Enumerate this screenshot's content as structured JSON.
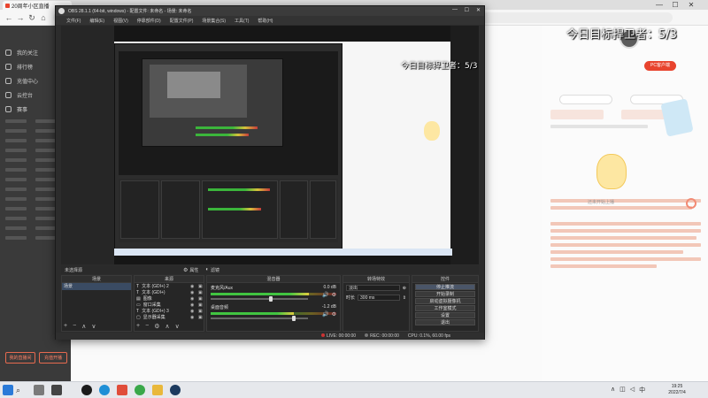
{
  "browser": {
    "tab_title": "20周年小区直播",
    "minimize": "—",
    "maximize": "☐",
    "close": "✕",
    "back": "←",
    "forward": "→",
    "refresh": "↻",
    "home": "⌂"
  },
  "site": {
    "sidebar_items": [
      "我的关注",
      "排行榜",
      "充值中心",
      "云控台",
      "赛事"
    ],
    "sidebar_buttons": [
      "我的直播间",
      "充值开播"
    ],
    "overlay_text": "今日目标捍卫者：5/3",
    "badge": "PC客户端",
    "mascot_label": "还未开始上播"
  },
  "obs": {
    "title": "OBS 28.1.1 (64-bit, windows) - 配置文件: 未命名 - 场景: 未命名",
    "menu": [
      "文件(F)",
      "编辑(E)",
      "视图(V)",
      "停靠部件(D)",
      "配置文件(P)",
      "场景集合(S)",
      "工具(T)",
      "帮助(H)"
    ],
    "preview_overlay": "今日目标捍卫者：5/3",
    "scene_bar": {
      "scene": "未选择源",
      "properties": "属性",
      "filters": "滤镜"
    },
    "docks": {
      "scenes": {
        "title": "场景",
        "items": [
          "场景"
        ]
      },
      "sources": {
        "title": "来源",
        "items": [
          "文本 (GDI+) 2",
          "文本 (GDI+)",
          "图像",
          "窗口采集",
          "文本 (GDI+) 3",
          "显示器采集"
        ]
      },
      "mixer": {
        "title": "混音器",
        "channels": [
          {
            "name": "麦克风/Aux",
            "db": "0.0 dB",
            "level": 0.78,
            "volume": 0.62
          },
          {
            "name": "桌面音频",
            "db": "-1.2 dB",
            "level": 0.66,
            "volume": 0.85
          }
        ]
      },
      "transitions": {
        "title": "转场特效",
        "type": "淡出",
        "duration_label": "时长",
        "duration": "300 ms"
      },
      "controls": {
        "title": "控件",
        "buttons": [
          "停止推流",
          "开始录制",
          "启动虚拟摄像机",
          "工作室模式",
          "设置",
          "退出"
        ]
      }
    },
    "status": {
      "live_label": "LIVE:",
      "live_time": "00:00:00",
      "rec_label": "REC:",
      "rec_time": "00:00:00",
      "cpu": "CPU: 0.1%, 60.00 fps"
    }
  },
  "taskbar": {
    "time": "19:25",
    "date": "2022/7/4"
  }
}
